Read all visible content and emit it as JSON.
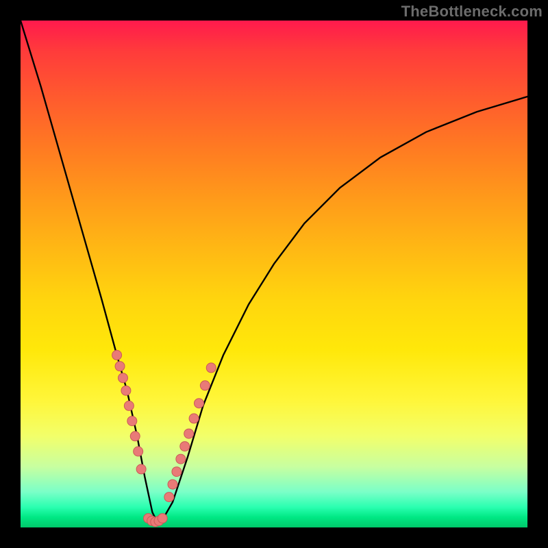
{
  "watermark": "TheBottleneck.com",
  "colors": {
    "curve": "#000000",
    "dot_fill": "#e97a77",
    "dot_stroke": "#c95a57",
    "background_frame": "#000000"
  },
  "chart_data": {
    "type": "line",
    "title": "",
    "xlabel": "",
    "ylabel": "",
    "xlim": [
      0,
      100
    ],
    "ylim": [
      0,
      100
    ],
    "grid": false,
    "series": [
      {
        "name": "bottleneck-curve",
        "x": [
          0,
          4,
          8,
          12,
          16,
          19,
          21,
          23,
          24.5,
          26,
          27,
          28,
          30,
          33,
          36,
          40,
          45,
          50,
          56,
          63,
          71,
          80,
          90,
          100
        ],
        "y": [
          100,
          87,
          73,
          59,
          45,
          34,
          27,
          18,
          10,
          3,
          1,
          1.5,
          5,
          14,
          24,
          34,
          44,
          52,
          60,
          67,
          73,
          78,
          82,
          85
        ]
      }
    ],
    "annotations": {
      "dots": {
        "note": "salmon dot clusters along the curve near the valley",
        "left_cluster_x": [
          19.0,
          19.6,
          20.2,
          20.8,
          21.4,
          22.0,
          22.6,
          23.2,
          23.8
        ],
        "left_cluster_y": [
          34.0,
          31.8,
          29.5,
          27.0,
          24.0,
          21.0,
          18.0,
          15.0,
          11.5
        ],
        "bottom_cluster_x": [
          25.2,
          25.9,
          26.6,
          27.3,
          28.0
        ],
        "bottom_cluster_y": [
          1.8,
          1.3,
          1.1,
          1.3,
          1.8
        ],
        "right_cluster_x": [
          29.3,
          30.0,
          30.8,
          31.6,
          32.4,
          33.2,
          34.2,
          35.2,
          36.4,
          37.6
        ],
        "right_cluster_y": [
          6.0,
          8.5,
          11.0,
          13.5,
          16.0,
          18.5,
          21.5,
          24.5,
          28.0,
          31.5
        ]
      }
    }
  }
}
